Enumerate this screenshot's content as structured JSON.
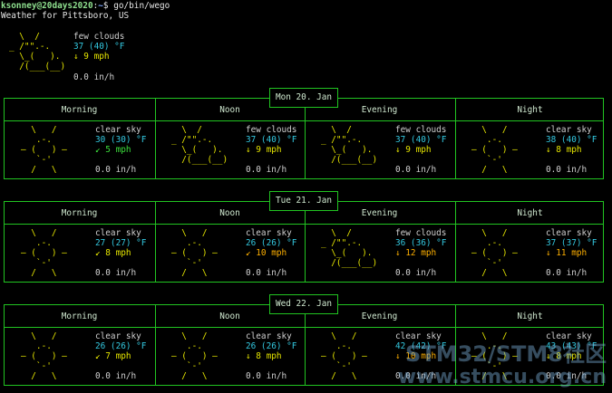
{
  "prompt": {
    "user": "ksonney@20days2020",
    "sep": ":",
    "path": "~",
    "symbol": "$",
    "command": " go/bin/wego"
  },
  "location": "Weather for Pittsboro, US",
  "current": {
    "art": [
      "  \\  /",
      "_ /\"\".-.",
      "  \\_(   ).",
      "  /(___(__)"
    ],
    "desc": "few clouds",
    "temp": "37 (40) °F",
    "wind": "↓ 9 mph",
    "precip": "0.0 in/h"
  },
  "periods": [
    "Morning",
    "Noon",
    "Evening",
    "Night"
  ],
  "days": [
    {
      "label": "Mon 20. Jan",
      "cells": [
        {
          "art": [
            "  \\   /",
            "   .-.",
            "― (   ) ―",
            "   `-'",
            "  /   \\"
          ],
          "desc": "clear sky",
          "temp": "30 (30) °F",
          "wind": "↙ 5 mph",
          "precip": "0.0 in/h"
        },
        {
          "art": [
            "  \\  /",
            "_ /\"\".-.",
            "  \\_(   ).",
            "  /(___(__)",
            ""
          ],
          "desc": "few clouds",
          "temp": "37 (40) °F",
          "wind": "↓ 9 mph",
          "precip": "0.0 in/h"
        },
        {
          "art": [
            "  \\  /",
            "_ /\"\".-.",
            "  \\_(   ).",
            "  /(___(__)",
            ""
          ],
          "desc": "few clouds",
          "temp": "37 (40) °F",
          "wind": "↓ 9 mph",
          "precip": "0.0 in/h"
        },
        {
          "art": [
            "  \\   /",
            "   .-.",
            "― (   ) ―",
            "   `-'",
            "  /   \\"
          ],
          "desc": "clear sky",
          "temp": "38 (40) °F",
          "wind": "↓ 8 mph",
          "precip": "0.0 in/h"
        }
      ]
    },
    {
      "label": "Tue 21. Jan",
      "cells": [
        {
          "art": [
            "  \\   /",
            "   .-.",
            "― (   ) ―",
            "   `-'",
            "  /   \\"
          ],
          "desc": "clear sky",
          "temp": "27 (27) °F",
          "wind": "↙ 8 mph",
          "precip": "0.0 in/h"
        },
        {
          "art": [
            "  \\   /",
            "   .-.",
            "― (   ) ―",
            "   `-'",
            "  /   \\"
          ],
          "desc": "clear sky",
          "temp": "26 (26) °F",
          "wind": "↙ 10 mph",
          "precip": "0.0 in/h"
        },
        {
          "art": [
            "  \\  /",
            "_ /\"\".-.",
            "  \\_(   ).",
            "  /(___(__)",
            ""
          ],
          "desc": "few clouds",
          "temp": "36 (36) °F",
          "wind": "↓ 12 mph",
          "precip": "0.0 in/h"
        },
        {
          "art": [
            "  \\   /",
            "   .-.",
            "― (   ) ―",
            "   `-'",
            "  /   \\"
          ],
          "desc": "clear sky",
          "temp": "37 (37) °F",
          "wind": "↓ 11 mph",
          "precip": "0.0 in/h"
        }
      ]
    },
    {
      "label": "Wed 22. Jan",
      "cells": [
        {
          "art": [
            "  \\   /",
            "   .-.",
            "― (   ) ―",
            "   `-'",
            "  /   \\"
          ],
          "desc": "clear sky",
          "temp": "26 (26) °F",
          "wind": "↙ 7 mph",
          "precip": "0.0 in/h"
        },
        {
          "art": [
            "  \\   /",
            "   .-.",
            "― (   ) ―",
            "   `-'",
            "  /   \\"
          ],
          "desc": "clear sky",
          "temp": "26 (26) °F",
          "wind": "↓ 8 mph",
          "precip": "0.0 in/h"
        },
        {
          "art": [
            "  \\   /",
            "   .-.",
            "― (   ) ―",
            "   `-'",
            "  /   \\"
          ],
          "desc": "clear sky",
          "temp": "42 (42) °F",
          "wind": "↓ 10 mph",
          "precip": "0.0 in/h"
        },
        {
          "art": [
            "  \\   /",
            "   .-.",
            "― (   ) ―",
            "   `-'",
            "  /   \\"
          ],
          "desc": "clear sky",
          "temp": "43 (43) °F",
          "wind": "↓ 8 mph",
          "precip": "0.0 in/h"
        }
      ]
    }
  ],
  "watermark": {
    "line1": "STM32/STM8社区",
    "line2": "www.stmcu.org.cn"
  }
}
